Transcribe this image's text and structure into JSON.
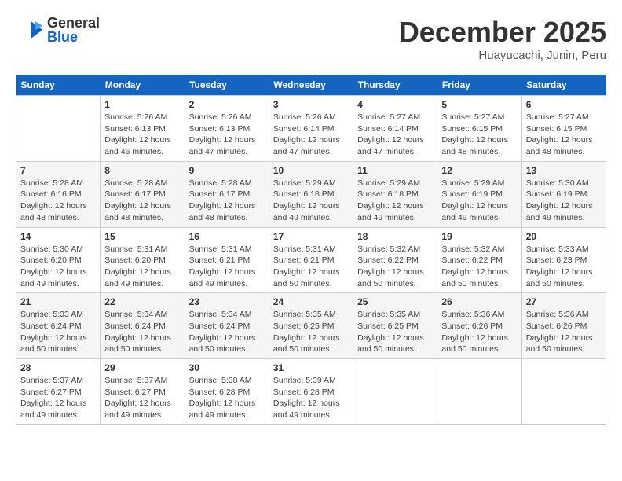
{
  "header": {
    "logo_general": "General",
    "logo_blue": "Blue",
    "month_title": "December 2025",
    "subtitle": "Huayucachi, Junin, Peru"
  },
  "weekdays": [
    "Sunday",
    "Monday",
    "Tuesday",
    "Wednesday",
    "Thursday",
    "Friday",
    "Saturday"
  ],
  "weeks": [
    [
      {
        "day": "",
        "sunrise": "",
        "sunset": "",
        "daylight": ""
      },
      {
        "day": "1",
        "sunrise": "Sunrise: 5:26 AM",
        "sunset": "Sunset: 6:13 PM",
        "daylight": "Daylight: 12 hours and 46 minutes."
      },
      {
        "day": "2",
        "sunrise": "Sunrise: 5:26 AM",
        "sunset": "Sunset: 6:13 PM",
        "daylight": "Daylight: 12 hours and 47 minutes."
      },
      {
        "day": "3",
        "sunrise": "Sunrise: 5:26 AM",
        "sunset": "Sunset: 6:14 PM",
        "daylight": "Daylight: 12 hours and 47 minutes."
      },
      {
        "day": "4",
        "sunrise": "Sunrise: 5:27 AM",
        "sunset": "Sunset: 6:14 PM",
        "daylight": "Daylight: 12 hours and 47 minutes."
      },
      {
        "day": "5",
        "sunrise": "Sunrise: 5:27 AM",
        "sunset": "Sunset: 6:15 PM",
        "daylight": "Daylight: 12 hours and 48 minutes."
      },
      {
        "day": "6",
        "sunrise": "Sunrise: 5:27 AM",
        "sunset": "Sunset: 6:15 PM",
        "daylight": "Daylight: 12 hours and 48 minutes."
      }
    ],
    [
      {
        "day": "7",
        "sunrise": "Sunrise: 5:28 AM",
        "sunset": "Sunset: 6:16 PM",
        "daylight": "Daylight: 12 hours and 48 minutes."
      },
      {
        "day": "8",
        "sunrise": "Sunrise: 5:28 AM",
        "sunset": "Sunset: 6:17 PM",
        "daylight": "Daylight: 12 hours and 48 minutes."
      },
      {
        "day": "9",
        "sunrise": "Sunrise: 5:28 AM",
        "sunset": "Sunset: 6:17 PM",
        "daylight": "Daylight: 12 hours and 48 minutes."
      },
      {
        "day": "10",
        "sunrise": "Sunrise: 5:29 AM",
        "sunset": "Sunset: 6:18 PM",
        "daylight": "Daylight: 12 hours and 49 minutes."
      },
      {
        "day": "11",
        "sunrise": "Sunrise: 5:29 AM",
        "sunset": "Sunset: 6:18 PM",
        "daylight": "Daylight: 12 hours and 49 minutes."
      },
      {
        "day": "12",
        "sunrise": "Sunrise: 5:29 AM",
        "sunset": "Sunset: 6:19 PM",
        "daylight": "Daylight: 12 hours and 49 minutes."
      },
      {
        "day": "13",
        "sunrise": "Sunrise: 5:30 AM",
        "sunset": "Sunset: 6:19 PM",
        "daylight": "Daylight: 12 hours and 49 minutes."
      }
    ],
    [
      {
        "day": "14",
        "sunrise": "Sunrise: 5:30 AM",
        "sunset": "Sunset: 6:20 PM",
        "daylight": "Daylight: 12 hours and 49 minutes."
      },
      {
        "day": "15",
        "sunrise": "Sunrise: 5:31 AM",
        "sunset": "Sunset: 6:20 PM",
        "daylight": "Daylight: 12 hours and 49 minutes."
      },
      {
        "day": "16",
        "sunrise": "Sunrise: 5:31 AM",
        "sunset": "Sunset: 6:21 PM",
        "daylight": "Daylight: 12 hours and 49 minutes."
      },
      {
        "day": "17",
        "sunrise": "Sunrise: 5:31 AM",
        "sunset": "Sunset: 6:21 PM",
        "daylight": "Daylight: 12 hours and 50 minutes."
      },
      {
        "day": "18",
        "sunrise": "Sunrise: 5:32 AM",
        "sunset": "Sunset: 6:22 PM",
        "daylight": "Daylight: 12 hours and 50 minutes."
      },
      {
        "day": "19",
        "sunrise": "Sunrise: 5:32 AM",
        "sunset": "Sunset: 6:22 PM",
        "daylight": "Daylight: 12 hours and 50 minutes."
      },
      {
        "day": "20",
        "sunrise": "Sunrise: 5:33 AM",
        "sunset": "Sunset: 6:23 PM",
        "daylight": "Daylight: 12 hours and 50 minutes."
      }
    ],
    [
      {
        "day": "21",
        "sunrise": "Sunrise: 5:33 AM",
        "sunset": "Sunset: 6:24 PM",
        "daylight": "Daylight: 12 hours and 50 minutes."
      },
      {
        "day": "22",
        "sunrise": "Sunrise: 5:34 AM",
        "sunset": "Sunset: 6:24 PM",
        "daylight": "Daylight: 12 hours and 50 minutes."
      },
      {
        "day": "23",
        "sunrise": "Sunrise: 5:34 AM",
        "sunset": "Sunset: 6:24 PM",
        "daylight": "Daylight: 12 hours and 50 minutes."
      },
      {
        "day": "24",
        "sunrise": "Sunrise: 5:35 AM",
        "sunset": "Sunset: 6:25 PM",
        "daylight": "Daylight: 12 hours and 50 minutes."
      },
      {
        "day": "25",
        "sunrise": "Sunrise: 5:35 AM",
        "sunset": "Sunset: 6:25 PM",
        "daylight": "Daylight: 12 hours and 50 minutes."
      },
      {
        "day": "26",
        "sunrise": "Sunrise: 5:36 AM",
        "sunset": "Sunset: 6:26 PM",
        "daylight": "Daylight: 12 hours and 50 minutes."
      },
      {
        "day": "27",
        "sunrise": "Sunrise: 5:36 AM",
        "sunset": "Sunset: 6:26 PM",
        "daylight": "Daylight: 12 hours and 50 minutes."
      }
    ],
    [
      {
        "day": "28",
        "sunrise": "Sunrise: 5:37 AM",
        "sunset": "Sunset: 6:27 PM",
        "daylight": "Daylight: 12 hours and 49 minutes."
      },
      {
        "day": "29",
        "sunrise": "Sunrise: 5:37 AM",
        "sunset": "Sunset: 6:27 PM",
        "daylight": "Daylight: 12 hours and 49 minutes."
      },
      {
        "day": "30",
        "sunrise": "Sunrise: 5:38 AM",
        "sunset": "Sunset: 6:28 PM",
        "daylight": "Daylight: 12 hours and 49 minutes."
      },
      {
        "day": "31",
        "sunrise": "Sunrise: 5:39 AM",
        "sunset": "Sunset: 6:28 PM",
        "daylight": "Daylight: 12 hours and 49 minutes."
      },
      {
        "day": "",
        "sunrise": "",
        "sunset": "",
        "daylight": ""
      },
      {
        "day": "",
        "sunrise": "",
        "sunset": "",
        "daylight": ""
      },
      {
        "day": "",
        "sunrise": "",
        "sunset": "",
        "daylight": ""
      }
    ]
  ]
}
